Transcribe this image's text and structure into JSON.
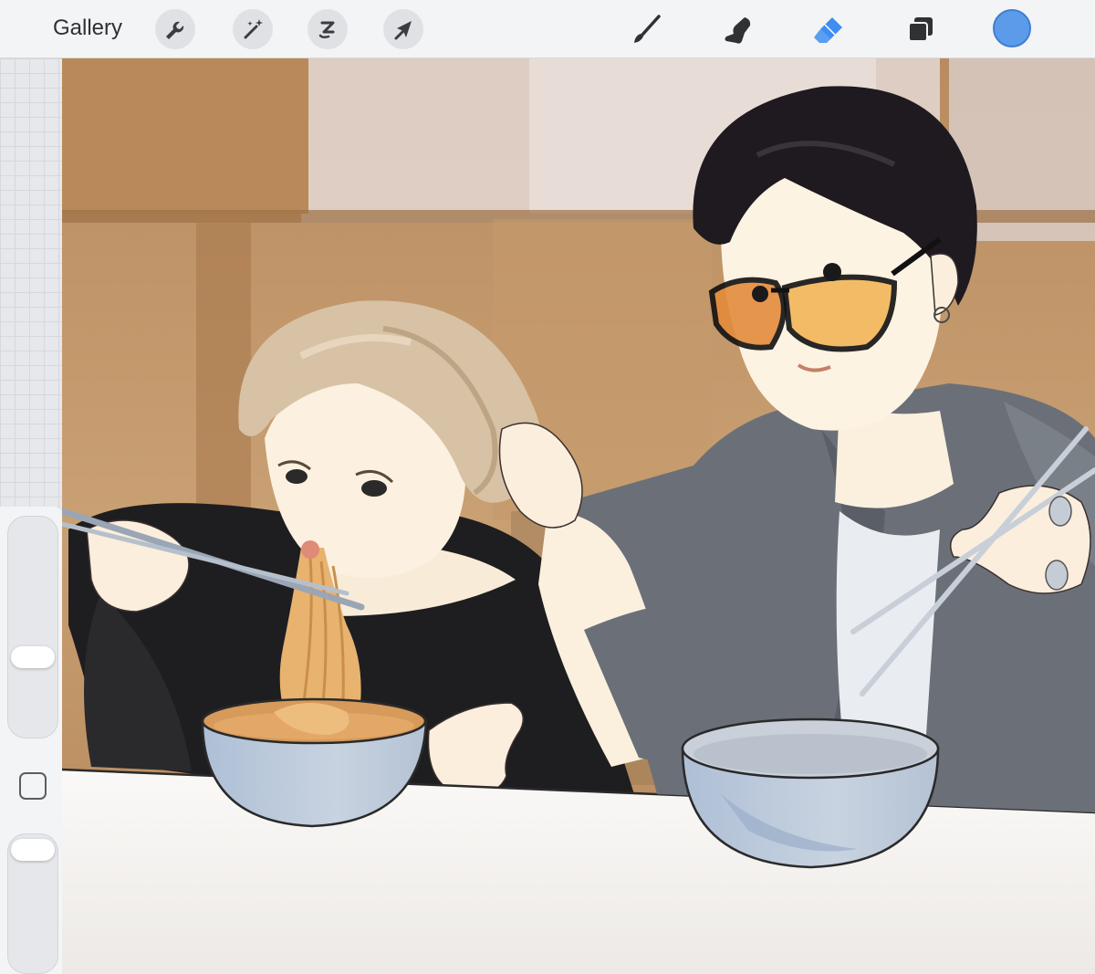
{
  "toolbar": {
    "gallery_label": "Gallery",
    "left_tools": [
      "actions",
      "adjustments",
      "selection",
      "transform"
    ],
    "right_tools": [
      "brush",
      "smudge",
      "eraser",
      "layers"
    ],
    "active_tool": "eraser",
    "current_color": "#5b9bea"
  },
  "sidebar": {
    "brush_size": 0.35,
    "opacity": 1.0
  },
  "canvas": {
    "artwork": "illustration"
  },
  "colors": {
    "accent": "#3d8ef0",
    "toolbar_bg": "#f3f4f6"
  }
}
